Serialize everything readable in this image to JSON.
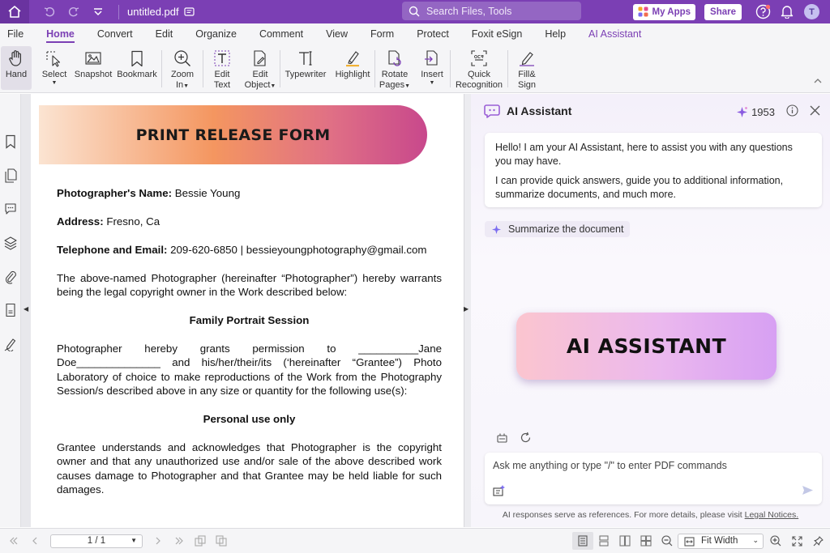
{
  "titlebar": {
    "filename": "untitled.pdf",
    "search_placeholder": "Search Files, Tools",
    "my_apps_label": "My Apps",
    "share_label": "Share",
    "avatar_initial": "T"
  },
  "menu": {
    "items": [
      "File",
      "Home",
      "Convert",
      "Edit",
      "Organize",
      "Comment",
      "View",
      "Form",
      "Protect",
      "Foxit eSign",
      "Help",
      "AI Assistant"
    ],
    "active": "Home"
  },
  "toolbar": {
    "hand": "Hand",
    "select": "Select",
    "snapshot": "Snapshot",
    "bookmark": "Bookmark",
    "zoom_in_1": "Zoom",
    "zoom_in_2": "In",
    "edit_text_1": "Edit",
    "edit_text_2": "Text",
    "edit_object_1": "Edit",
    "edit_object_2": "Object",
    "typewriter": "Typewriter",
    "highlight": "Highlight",
    "rotate_pages_1": "Rotate",
    "rotate_pages_2": "Pages",
    "insert": "Insert",
    "quick_recognition_1": "Quick",
    "quick_recognition_2": "Recognition",
    "fill_sign_1": "Fill&",
    "fill_sign_2": "Sign"
  },
  "document": {
    "banner_title": "PRINT RELEASE FORM",
    "photographer_label": "Photographer's Name:",
    "photographer_value": " Bessie Young",
    "address_label": "Address:",
    "address_value": " Fresno, Ca",
    "contact_label": "Telephone and Email:",
    "contact_value": " 209-620-6850 | bessieyoungphotography@gmail.com",
    "para1": "The above-named Photographer (hereinafter “Photographer”) hereby warrants being the legal copyright owner in the Work described below:",
    "session_title": "Family Portrait Session",
    "para2": "Photographer hereby grants permission to __________Jane Doe______________ and his/her/their/its (‘hereinafter “Grantee”) Photo Laboratory of choice to make reproductions of the Work from the Photography Session/s described above in any size or quantity for the following use(s):",
    "use_title": "Personal use only",
    "para3": "Grantee understands and acknowledges that Photographer is the copyright owner and that any unauthorized use and/or sale of the above described work causes damage to Photographer and that Grantee may be held liable for such damages."
  },
  "ai_panel": {
    "title": "AI Assistant",
    "credits": "1953",
    "greeting_1": "Hello! I am your AI Assistant, here to assist you with any questions you may have.",
    "greeting_2": "I can provide quick answers, guide you to additional information, summarize documents, and much more.",
    "summarize_chip": "Summarize the document",
    "badge_text": "AI ASSISTANT",
    "input_placeholder": "Ask me anything or type \"/\" to enter PDF commands",
    "disclaimer": "AI responses serve as references. For more details, please visit ",
    "legal_link": "Legal Notices."
  },
  "statusbar": {
    "page_indicator": "1 / 1",
    "zoom_mode": "Fit Width"
  },
  "colors": {
    "brand_purple": "#7b3fb4",
    "banner_orange": "#f49660",
    "banner_magenta": "#c8488c"
  }
}
